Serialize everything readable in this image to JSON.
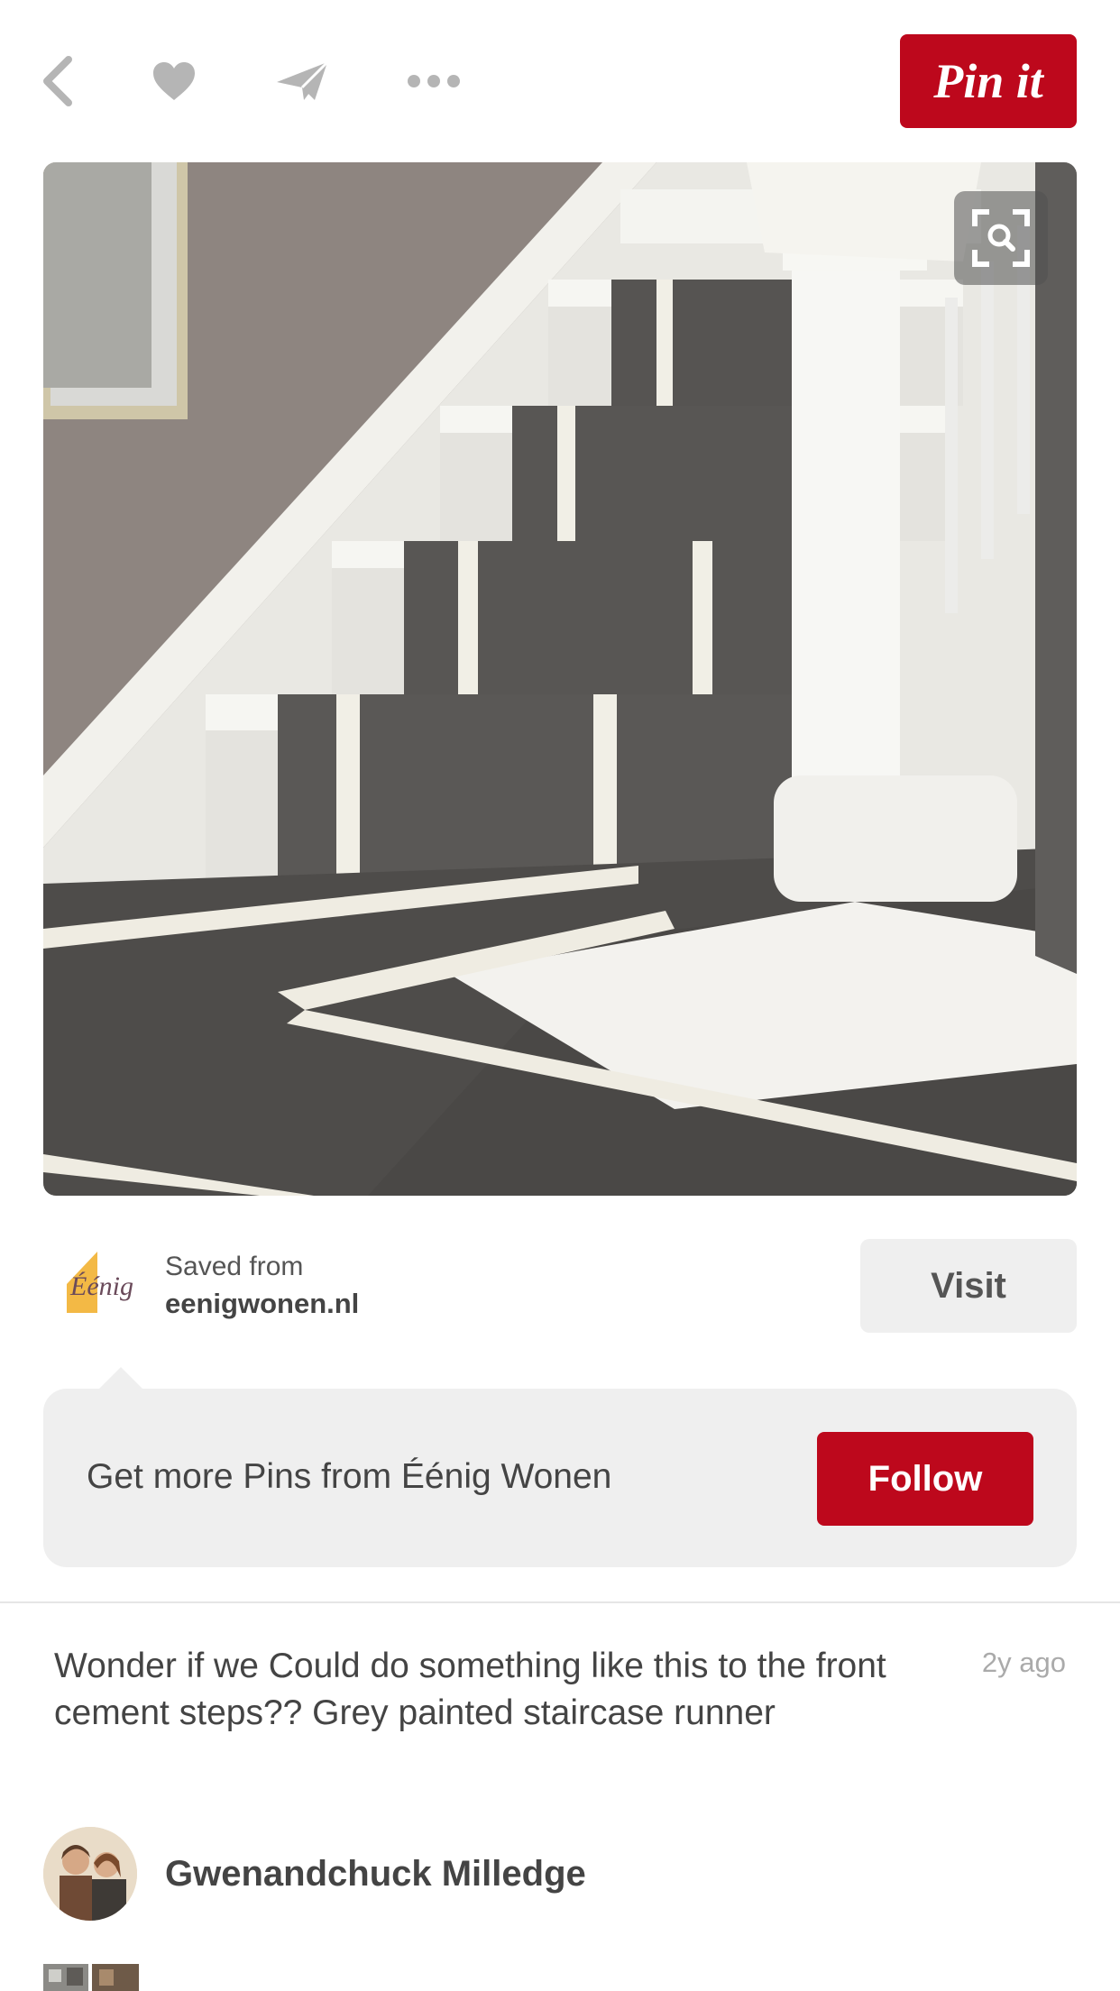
{
  "topbar": {
    "icons": [
      "back-chevron-icon",
      "heart-icon",
      "send-icon",
      "more-icon"
    ],
    "pin_button": "Pin it"
  },
  "pin": {
    "image": {
      "subject": "grey painted staircase runner",
      "zoom_icon": "visual-search-icon"
    },
    "saved_from": {
      "label": "Saved from",
      "site": "eenigwonen.nl",
      "logo_text": "Éénig",
      "visit_label": "Visit"
    },
    "follow_card": {
      "text": "Get more Pins from Éénig Wonen",
      "follow_label": "Follow"
    },
    "description": "Wonder if we Could do something like this to the front cement steps?? Grey painted staircase runner",
    "time_ago": "2y ago",
    "pinner": {
      "name": "Gwenandchuck Milledge"
    }
  },
  "colors": {
    "brand_red": "#bd081c",
    "icon_grey": "#b5b5b5",
    "card_bg": "#efefef"
  }
}
